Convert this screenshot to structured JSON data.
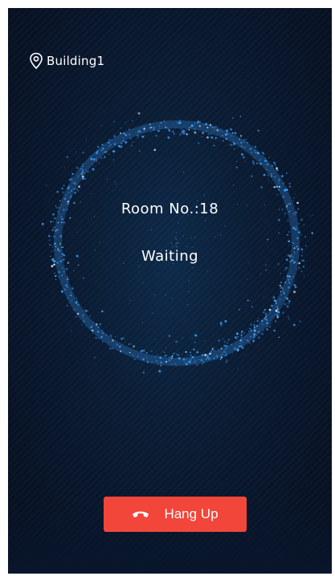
{
  "location": {
    "icon": "location-pin-icon",
    "label": "Building1"
  },
  "call": {
    "room_label": "Room No.:18",
    "status": "Waiting"
  },
  "actions": {
    "hangup_icon": "phone-hangup-icon",
    "hangup_label": "Hang Up"
  },
  "colors": {
    "background": "#0a1d35",
    "ring_particles": "#3aa0ff",
    "hangup_button": "#f2463a",
    "text": "#ffffff"
  }
}
